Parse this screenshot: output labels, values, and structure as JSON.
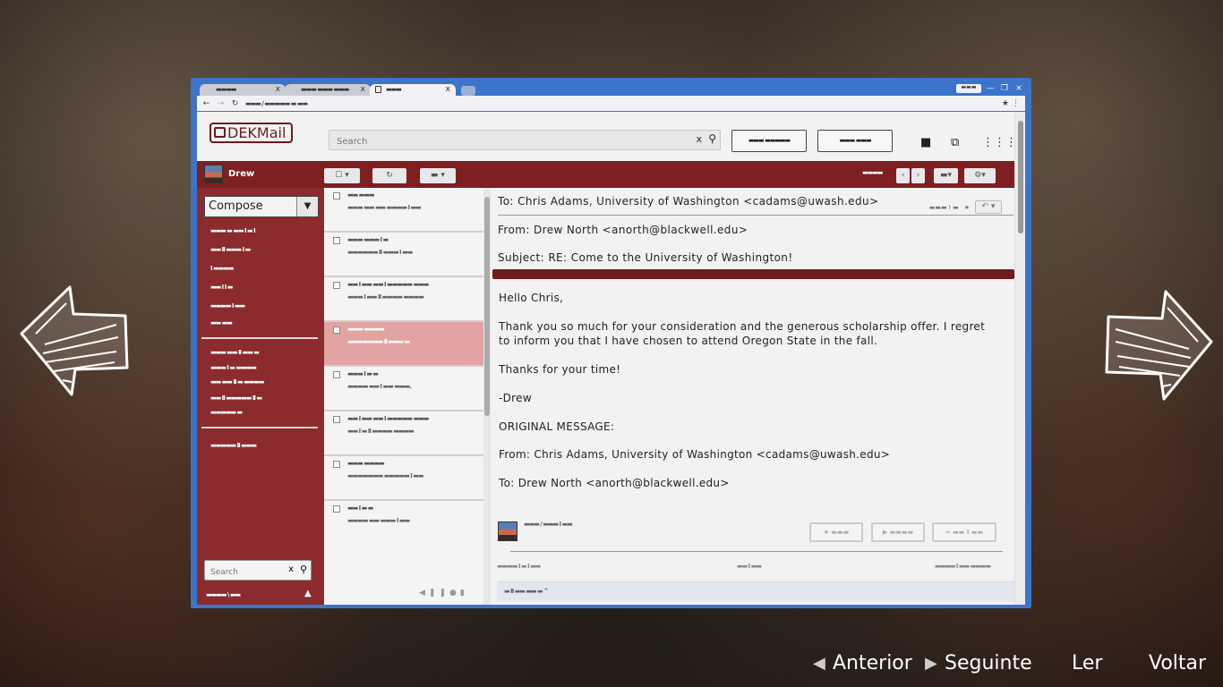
{
  "browser": {
    "tabs": [
      {
        "title": "▬▬▬▬",
        "close": "x"
      },
      {
        "title": "▬▬▬ ▬▬▬ ▬▬▬",
        "close": "x"
      },
      {
        "title": "▬▬▬",
        "close": "x"
      }
    ],
    "url": "▬▬▬ / ▬▬▬▬▬ ▬ ▬▬",
    "window_controls": [
      "—",
      "❐",
      "×"
    ]
  },
  "app": {
    "logo": "DEKMail",
    "search_placeholder": "Search",
    "search_clear": "x",
    "top_buttons": [
      "▬▬▬ ▬▬▬▬▬",
      "▬▬▬ ▬▬▬"
    ],
    "user_name": "Drew",
    "pager_text": "▬▬▬▬",
    "compose_label": "Compose",
    "sidebar_search_placeholder": "Search",
    "sidebar_search_clear": "x",
    "sidebar_footer": "▬▬▬▬ \\ ▬▬",
    "folders_group1": [
      "▬▬▬ ▬ ▬▬ I ▬ I",
      "▬▬ II ▬▬▬ I ▬",
      "I ▬▬▬▬",
      "▬▬ I I ▬",
      "▬▬▬▬ I ▬▬",
      "▬▬ ▬▬"
    ],
    "folders_group2": [
      "▬▬▬ ▬▬ II ▬▬ ▬",
      "▬▬▬ I ▬ ▬▬▬▬",
      "▬▬ ▬▬ II ▬ ▬▬▬▬",
      "▬▬ II ▬▬▬▬▬ II ▬",
      "▬▬▬▬▬ ▬"
    ],
    "folders_group3": [
      "▬▬▬▬▬ II ▬▬▬"
    ]
  },
  "mail_list": [
    {
      "line1": "▬▬ ▬▬▬",
      "line2": "▬▬▬ ▬▬ ▬▬ ▬▬▬▬ I ▬▬"
    },
    {
      "line1": "▬▬▬ ▬▬▬ I ▬",
      "line2": "▬▬▬▬▬▬ II ▬▬▬ I ▬▬"
    },
    {
      "line1": "▬▬ I ▬▬ ▬▬ I ▬▬▬▬▬ ▬▬▬",
      "line2": "▬▬▬ I ▬▬ II ▬▬▬▬ ▬▬▬▬"
    },
    {
      "line1": "▬▬▬ ▬▬▬▬",
      "line2": "▬▬▬▬▬▬▬ II ▬▬▬ ▬"
    },
    {
      "line1": "▬▬▬ I ▬ ▬",
      "line2": "▬▬▬▬ ▬▬ I ▬▬ ▬▬▬."
    },
    {
      "line1": "▬▬ I ▬▬ ▬▬ I ▬▬▬▬▬ ▬▬▬",
      "line2": "▬▬ I ▬ II ▬▬▬▬ ▬▬▬▬"
    },
    {
      "line1": "▬▬▬ ▬▬▬▬",
      "line2": "▬▬▬▬▬▬▬ ▬▬▬▬▬ I ▬▬"
    },
    {
      "line1": "▬▬ I ▬ ▬",
      "line2": "▬▬▬▬ ▬▬ ▬▬▬ I ▬▬"
    }
  ],
  "email": {
    "to": "To: Chris Adams, University of Washington <cadams@uwash.edu>",
    "from": "From: Drew North <anorth@blackwell.edu>",
    "subject": "Subject: RE: Come to the University of Washington!",
    "header_meta": "▬▬▬ I ▬",
    "body": {
      "greeting": "Hello Chris,",
      "para1_line1": "Thank you so much for your consideration and the generous scholarship offer. I regret",
      "para1_line2": "to inform you that I have chosen to attend Oregon State in the fall.",
      "thanks": "Thanks for your time!",
      "signoff": "-Drew",
      "original": "ORIGINAL MESSAGE:",
      "orig_from": "From: Chris Adams, University of Washington <cadams@uwash.edu>",
      "orig_to": "To: Drew North <anorth@blackwell.edu>"
    },
    "sig_text": "▬▬▬ / ▬▬▬ I ▬▬",
    "action_buttons": [
      "★ ▬▬▬",
      "▶ ▬▬▬▬",
      "⇨ ▬▬ I ▬▬"
    ],
    "footer_left": "▬▬▬▬ I ▬ I ▬▬",
    "footer_mid": "▬▬ I ▬▬",
    "footer_right": "▬▬▬▬ I ▬▬ ▬▬▬▬",
    "bottom_strip": "▬ II ▬▬ ▬▬ ▬ ^"
  },
  "game_nav": {
    "previous": "Anterior",
    "next": "Seguinte",
    "read": "Ler",
    "back": "Voltar"
  },
  "colors": {
    "accent_red": "#7e1f22",
    "sidebar_red": "#8b2b2d",
    "selected_mail": "#e2a3a3",
    "window_frame": "#3b74c9"
  }
}
